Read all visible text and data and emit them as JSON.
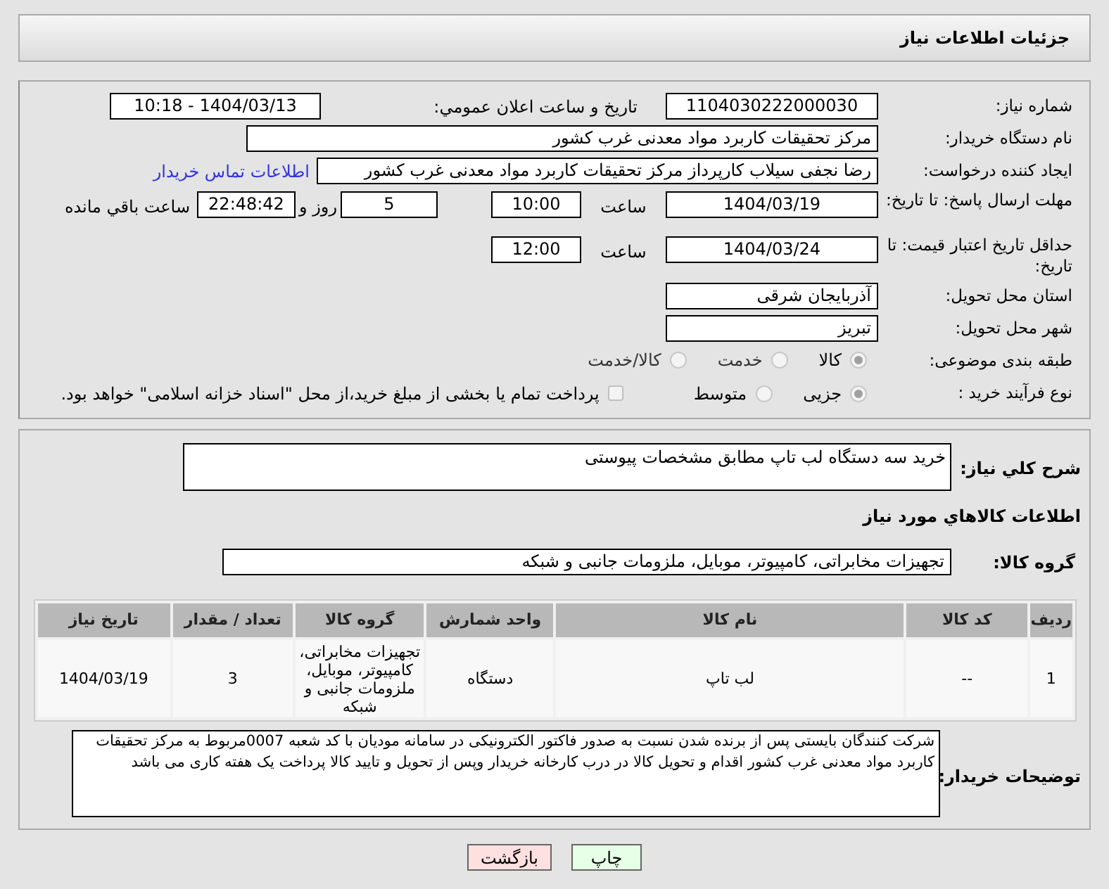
{
  "header": {
    "title": "جزئیات اطلاعات نیاز"
  },
  "need_number": {
    "label": "شماره نیاز:",
    "value": "1104030222000030"
  },
  "announce": {
    "label": "تاریخ و ساعت اعلان عمومي:",
    "value": "1404/03/13 - 10:18"
  },
  "buyer_org": {
    "label": "نام دستگاه خریدار:",
    "value": "مرکز تحقیقات کاربرد مواد معدنی غرب کشور"
  },
  "requester": {
    "label": "ایجاد کننده درخواست:",
    "value": "رضا نجفی سیلاب کارپرداز مرکز تحقیقات کاربرد مواد معدنی غرب کشور",
    "link": "اطلاعات تماس خریدار"
  },
  "deadline": {
    "label": "مهلت ارسال پاسخ: تا تاریخ:",
    "date": "1404/03/19",
    "time_label": "ساعت",
    "time": "10:00",
    "days": "5",
    "days_label": "روز و",
    "remaining": "22:48:42",
    "remaining_label": "ساعت باقي مانده"
  },
  "validity": {
    "label": "حداقل تاریخ اعتبار قیمت: تا تاریخ:",
    "date": "1404/03/24",
    "time_label": "ساعت",
    "time": "12:00"
  },
  "province": {
    "label": "استان محل تحویل:",
    "value": "آذربایجان شرقی"
  },
  "city": {
    "label": "شهر محل تحویل:",
    "value": "تبریز"
  },
  "category": {
    "label": "طبقه بندی موضوعی:",
    "options": [
      {
        "label": "کالا",
        "selected": true
      },
      {
        "label": "خدمت",
        "selected": false
      },
      {
        "label": "کالا/خدمت",
        "selected": false
      }
    ]
  },
  "purchase_type": {
    "label": "نوع فرآیند خرید :",
    "options": [
      {
        "label": "جزیی",
        "selected": true
      },
      {
        "label": "متوسط",
        "selected": false
      }
    ],
    "payment_note": {
      "checked": false,
      "text": "پرداخت تمام یا بخشی از مبلغ خرید،از محل \"اسناد خزانه اسلامی\" خواهد بود."
    }
  },
  "description": {
    "label": "شرح کلي نیاز:",
    "value": "خرید سه دستگاه لب تاپ مطابق مشخصات پیوستی"
  },
  "goods_heading": "اطلاعات کالاهاي مورد نیاز",
  "goods_group": {
    "label": "گروه کالا:",
    "value": "تجهیزات مخابراتی، کامپیوتر، موبایل، ملزومات جانبی و شبکه"
  },
  "table": {
    "columns": [
      "ردیف",
      "کد کالا",
      "نام کالا",
      "واحد شمارش",
      "گروه کالا",
      "تعداد / مقدار",
      "تاریخ نیاز"
    ],
    "rows": [
      [
        "1",
        "--",
        "لب تاپ",
        "دستگاه",
        "تجهیزات مخابراتی، کامپیوتر، موبایل، ملزومات جانبی و شبکه",
        "3",
        "1404/03/19"
      ]
    ]
  },
  "buyer_notes": {
    "label": "توضیحات خریدار:",
    "value": "شرکت کنندگان بایستی پس از برنده شدن نسبت به صدور فاکتور الکترونیکی در سامانه مودیان با کد شعبه 0007مربوط به مرکز تحقیقات کاربرد مواد معدنی غرب کشور اقدام و تحویل کالا در درب کارخانه خریدار  وپس از تحویل و تایید کالا پرداخت یک هفته کاری می باشد"
  },
  "buttons": [
    {
      "label": "چاپ",
      "kind": "print"
    },
    {
      "label": "بازگشت",
      "kind": "back"
    }
  ]
}
